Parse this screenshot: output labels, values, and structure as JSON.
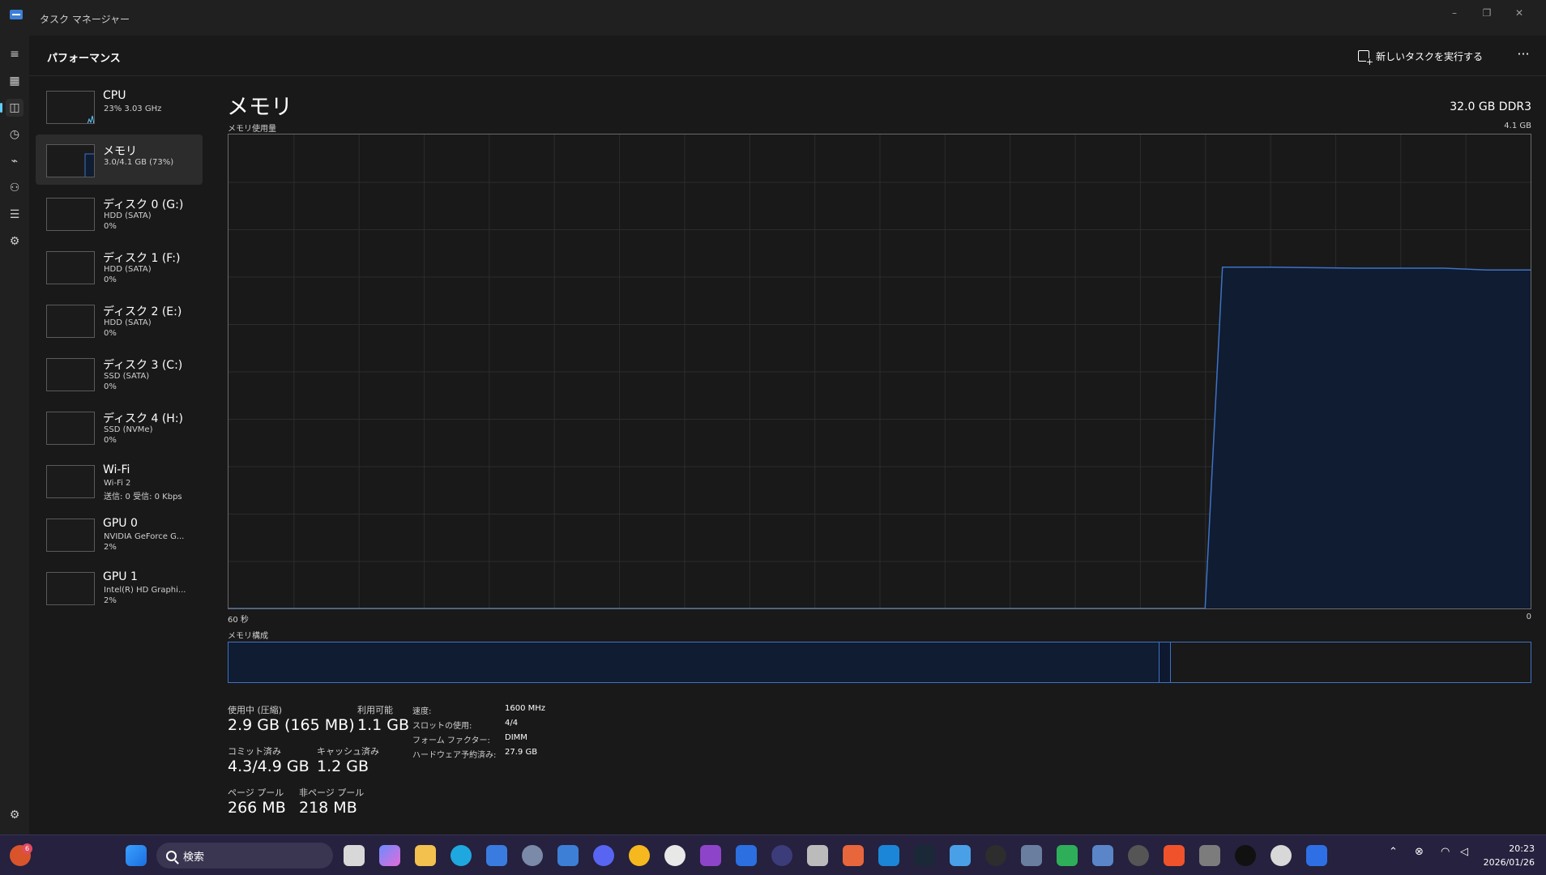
{
  "window": {
    "title": "タスク マネージャー",
    "minimize": "–",
    "restore": "❐",
    "close": "✕"
  },
  "header": {
    "page_title": "パフォーマンス",
    "run_task_label": "新しいタスクを実行する",
    "more": "···"
  },
  "sidebar": {
    "devices": [
      {
        "name": "CPU",
        "line1": "23%  3.03 GHz",
        "line2": ""
      },
      {
        "name": "メモリ",
        "line1": "3.0/4.1 GB (73%)",
        "line2": ""
      },
      {
        "name": "ディスク 0 (G:)",
        "line1": "HDD (SATA)",
        "line2": "0%"
      },
      {
        "name": "ディスク 1 (F:)",
        "line1": "HDD (SATA)",
        "line2": "0%"
      },
      {
        "name": "ディスク 2 (E:)",
        "line1": "HDD (SATA)",
        "line2": "0%"
      },
      {
        "name": "ディスク 3 (C:)",
        "line1": "SSD (SATA)",
        "line2": "0%"
      },
      {
        "name": "ディスク 4 (H:)",
        "line1": "SSD (NVMe)",
        "line2": "0%"
      },
      {
        "name": "Wi-Fi",
        "line1": "Wi-Fi 2",
        "line2": "送信: 0 受信: 0 Kbps"
      },
      {
        "name": "GPU 0",
        "line1": "NVIDIA GeForce G...",
        "line2": "2%"
      },
      {
        "name": "GPU 1",
        "line1": "Intel(R) HD Graphi...",
        "line2": "2%"
      }
    ]
  },
  "memory": {
    "title": "メモリ",
    "spec": "32.0 GB DDR3",
    "usage_label": "メモリ使用量",
    "max_label": "4.1 GB",
    "time_left": "60 秒",
    "time_right": "0",
    "composition_label": "メモリ構成"
  },
  "stats": {
    "in_use_label": "使用中 (圧縮)",
    "in_use": "2.9 GB (165 MB)",
    "available_label": "利用可能",
    "available": "1.1 GB",
    "committed_label": "コミット済み",
    "committed": "4.3/4.9 GB",
    "cached_label": "キャッシュ済み",
    "cached": "1.2 GB",
    "paged_label": "ページ プール",
    "paged": "266 MB",
    "nonpaged_label": "非ページ プール",
    "nonpaged": "218 MB",
    "speed_label": "速度:",
    "speed": "1600 MHz",
    "slots_label": "スロットの使用:",
    "slots": "4/4",
    "form_label": "フォーム ファクター:",
    "form": "DIMM",
    "reserved_label": "ハードウェア予約済み:",
    "reserved": "27.9 GB"
  },
  "taskbar": {
    "search_placeholder": "検索",
    "notification_count": "6",
    "time": "20:23",
    "date": "2026/01/26"
  },
  "chart_data": {
    "type": "area",
    "title": "メモリ使用量",
    "x_range_seconds": [
      60,
      0
    ],
    "ylim_gb": [
      0,
      4.1
    ],
    "series": [
      {
        "values_fraction": [
          [
            60,
            0
          ],
          [
            15.0,
            0
          ],
          [
            14.2,
            0.72
          ],
          [
            12,
            0.72
          ],
          [
            8,
            0.718
          ],
          [
            4,
            0.718
          ],
          [
            2,
            0.714
          ],
          [
            0,
            0.714
          ]
        ]
      }
    ],
    "grid": true,
    "accent": "#3f72c6",
    "fill": "#0f1c31"
  }
}
